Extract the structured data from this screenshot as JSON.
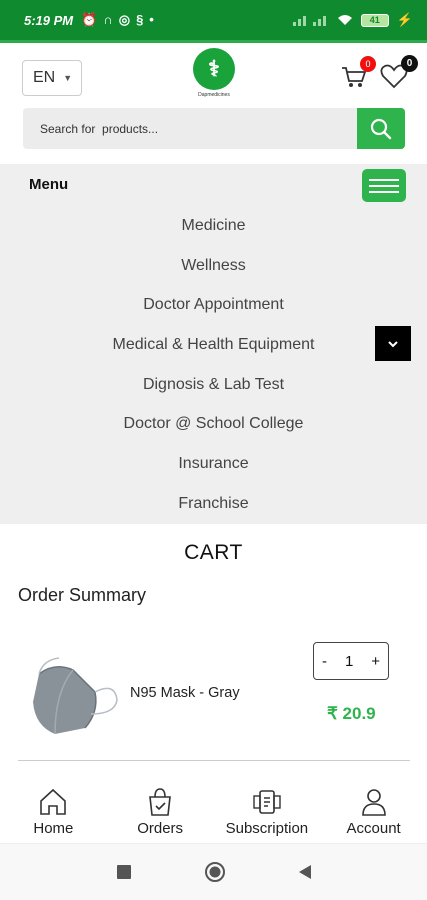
{
  "status_bar": {
    "time": "5:19 PM",
    "battery": "41"
  },
  "header": {
    "language": "EN",
    "logo_glyph": "⚕",
    "logo_text": "Dapmedicines",
    "cart_count": "0",
    "wishlist_count": "0"
  },
  "search": {
    "placeholder": "Search for  products..."
  },
  "menu": {
    "title": "Menu",
    "items": [
      "Medicine",
      "Wellness",
      "Doctor Appointment",
      "Medical & Health Equipment",
      "Dignosis & Lab Test",
      "Doctor @ School College",
      "Insurance",
      "Franchise"
    ]
  },
  "cart": {
    "title": "CART",
    "order_summary": "Order Summary",
    "items": [
      {
        "name": "N95 Mask - Gray",
        "quantity": "1",
        "price": "₹ 20.9",
        "minus": "-",
        "plus": "+"
      }
    ]
  },
  "bottom_nav": {
    "items": [
      {
        "label": "Home",
        "icon": "home-icon"
      },
      {
        "label": "Orders",
        "icon": "shopping-bag-icon"
      },
      {
        "label": "Subscription",
        "icon": "subscription-icon"
      },
      {
        "label": "Account",
        "icon": "user-icon"
      }
    ]
  },
  "colors": {
    "brand_green": "#2fb34d",
    "status_green": "#0f8a2f",
    "badge_red": "#ee1111"
  }
}
